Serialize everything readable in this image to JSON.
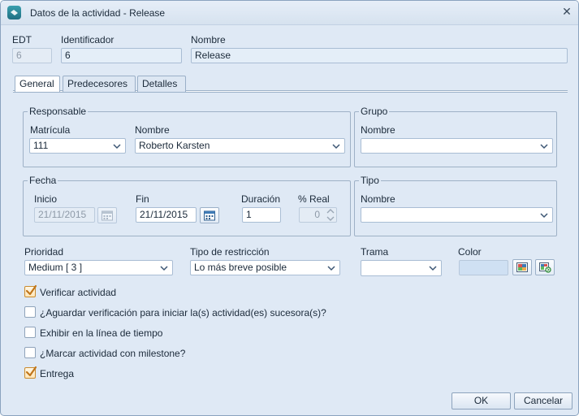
{
  "window": {
    "title": "Datos de la actividad - Release"
  },
  "header": {
    "edt_label": "EDT",
    "edt_value": "6",
    "id_label": "Identificador",
    "id_value": "6",
    "name_label": "Nombre",
    "name_value": "Release"
  },
  "tabs": [
    {
      "label": "General",
      "active": true
    },
    {
      "label": "Predecesores",
      "active": false
    },
    {
      "label": "Detalles",
      "active": false
    }
  ],
  "responsable": {
    "title": "Responsable",
    "matricula_label": "Matrícula",
    "matricula_value": "111",
    "nombre_label": "Nombre",
    "nombre_value": "Roberto Karsten"
  },
  "grupo": {
    "title": "Grupo",
    "nombre_label": "Nombre",
    "nombre_value": ""
  },
  "fecha": {
    "title": "Fecha",
    "inicio_label": "Inicio",
    "inicio_value": "21/11/2015",
    "fin_label": "Fin",
    "fin_value": "21/11/2015",
    "duracion_label": "Duración",
    "duracion_value": "1",
    "real_label": "% Real",
    "real_value": "0"
  },
  "tipo": {
    "title": "Tipo",
    "nombre_label": "Nombre",
    "nombre_value": ""
  },
  "prioridad": {
    "label": "Prioridad",
    "value": "Medium [ 3 ]"
  },
  "restriccion": {
    "label": "Tipo de restricción",
    "value": "Lo más breve posible"
  },
  "trama": {
    "label": "Trama",
    "value": ""
  },
  "color": {
    "label": "Color",
    "swatch": "#cfe0f3"
  },
  "checks": [
    {
      "label": "Verificar actividad",
      "checked": true
    },
    {
      "label": "¿Aguardar verificación para iniciar la(s) actividad(es) sucesora(s)?",
      "checked": false
    },
    {
      "label": "Exhibir en la línea de tiempo",
      "checked": false
    },
    {
      "label": "¿Marcar actividad con milestone?",
      "checked": false
    },
    {
      "label": "Entrega",
      "checked": true
    }
  ],
  "buttons": {
    "ok": "OK",
    "cancel": "Cancelar"
  },
  "colors": {
    "accent": "#c98b2e",
    "window_bg": "#dfe9f5",
    "border": "#9bb0c8"
  }
}
